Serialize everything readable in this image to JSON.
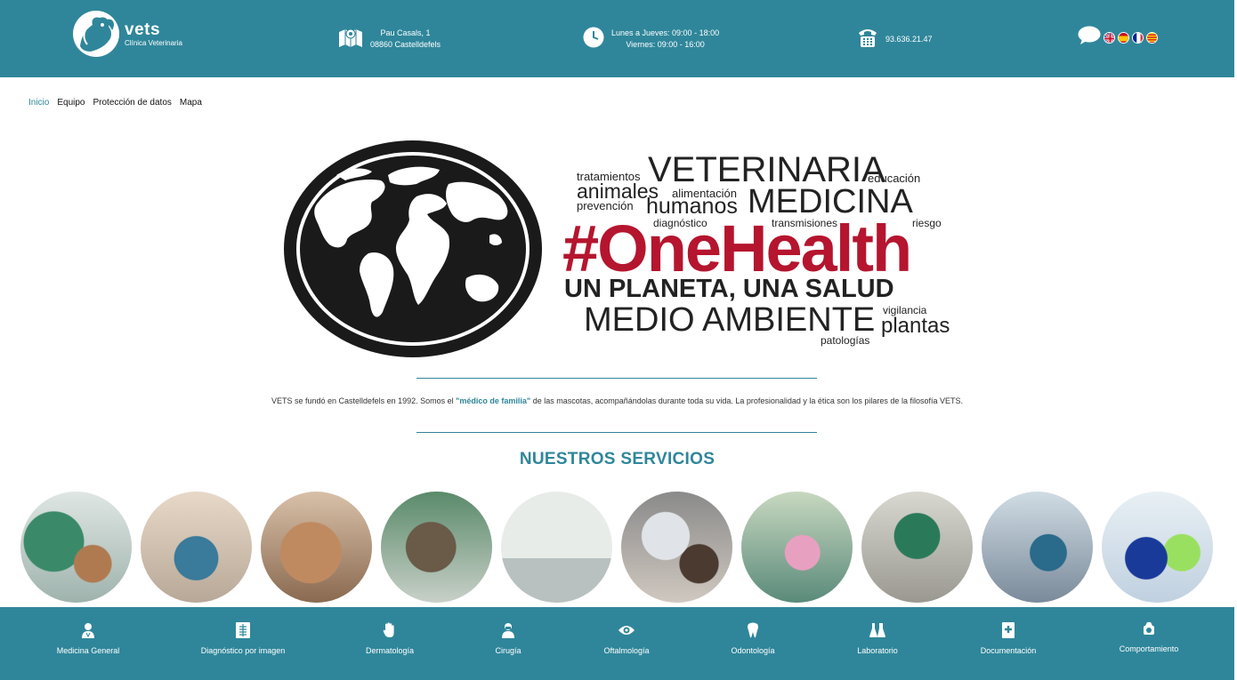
{
  "header": {
    "logo": {
      "name": "vets",
      "subtitle": "Clínica Veterinaria"
    },
    "address": {
      "line1": "Pau Casals, 1",
      "line2": "08860 Castelldefels",
      "icon": "map-icon"
    },
    "hours": {
      "line1": "Lunes a Jueves: 09:00 - 18:00",
      "line2": "Viernes: 09:00 - 16:00",
      "icon": "clock-icon"
    },
    "phone": {
      "number": "93.636.21.47",
      "icon": "phone-icon"
    },
    "chat_icon": "chat-bubble-icon",
    "languages": [
      "en",
      "es",
      "fr",
      "ca"
    ],
    "colors": {
      "primary": "#2f869a",
      "accent_red": "#b5152e"
    }
  },
  "nav": {
    "items": [
      {
        "label": "Inicio",
        "active": true
      },
      {
        "label": "Equipo",
        "active": false
      },
      {
        "label": "Protección de datos",
        "active": false
      },
      {
        "label": "Mapa",
        "active": false
      }
    ]
  },
  "hero": {
    "words": {
      "tratamientos": "tratamientos",
      "veterinaria": "VETERINARIA",
      "educacion": "educación",
      "animales": "animales",
      "alimentacion": "alimentación",
      "prevencion": "prevención",
      "humanos": "humanos",
      "medicina": "MEDICINA",
      "diagnostico": "diagnóstico",
      "transmisiones": "transmisiones",
      "riesgo": "riesgo",
      "onehealth": "#OneHealth",
      "planeta": "UN PLANETA, UNA SALUD",
      "medioambiente": "MEDIO AMBIENTE",
      "vigilancia": "vigilancia",
      "plantas": "plantas",
      "patologias": "patologías"
    }
  },
  "about": {
    "before": "VETS se fundó en Castelldefels en 1992. Somos el ",
    "highlight": "\"médico de familia\"",
    "after": " de las mascotas, acompañándolas durante toda su vida. La profesionalidad y la ética son los pilares de la filosofía VETS."
  },
  "services_title": "NUESTROS SERVICIOS",
  "services": [
    {
      "label": "Medicina General",
      "icon": "doctor-icon"
    },
    {
      "label": "Diagnóstico por imagen",
      "icon": "xray-icon"
    },
    {
      "label": "Dermatología",
      "icon": "hand-icon"
    },
    {
      "label": "Cirugía",
      "icon": "surgeon-icon"
    },
    {
      "label": "Oftalmología",
      "icon": "eye-icon"
    },
    {
      "label": "Odontología",
      "icon": "tooth-icon"
    },
    {
      "label": "Laboratorio",
      "icon": "flask-icon"
    },
    {
      "label": "Documentación",
      "icon": "medical-book-icon"
    },
    {
      "label": "Comportamiento",
      "icon": "pet-behavior-icon"
    }
  ]
}
